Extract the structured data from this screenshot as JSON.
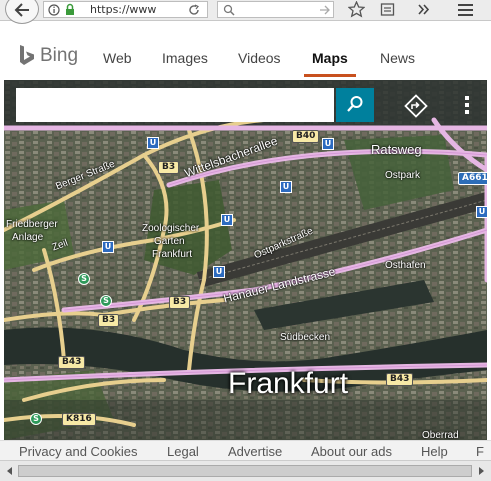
{
  "browser": {
    "url": "https://www",
    "search_placeholder": ""
  },
  "bing": {
    "logo_text": "Bing",
    "nav": [
      {
        "label": "Web"
      },
      {
        "label": "Images"
      },
      {
        "label": "Videos"
      },
      {
        "label": "Maps",
        "active": true
      },
      {
        "label": "News"
      }
    ],
    "accent_color": "#c8501e"
  },
  "map": {
    "search_value": "",
    "search_button_color": "#00809d",
    "city": "Frankfurt",
    "labels": {
      "berger": "Berger Straße",
      "wittels": "Wittelsbacherallee",
      "ratsweg": "Ratsweg",
      "ostpark": "Ostpark",
      "friedberger": "Friedberger",
      "anlage": "Anlage",
      "zeil": "Zeil",
      "zoo": "Zoologischer",
      "garten": "Garten",
      "frankfurt_zoo": "Frankfurt",
      "ostpark_strasse": "Ostparkstraße",
      "osthafen": "Osthafen",
      "hanauer": "Hanauer Landstrasse",
      "sudbecken": "Südbecken",
      "oberrad": "Oberrad"
    },
    "shields": {
      "b40": "B40",
      "b3a": "B3",
      "b3b": "B3",
      "b3c": "B3",
      "b43a": "B43",
      "b43b": "B43",
      "k816": "K816",
      "a661": "A661"
    },
    "ubahn_glyph": "U",
    "sbahn_glyph": "S"
  },
  "footer": {
    "links": [
      "Privacy and Cookies",
      "Legal",
      "Advertise",
      "About our ads",
      "Help",
      "F"
    ]
  }
}
